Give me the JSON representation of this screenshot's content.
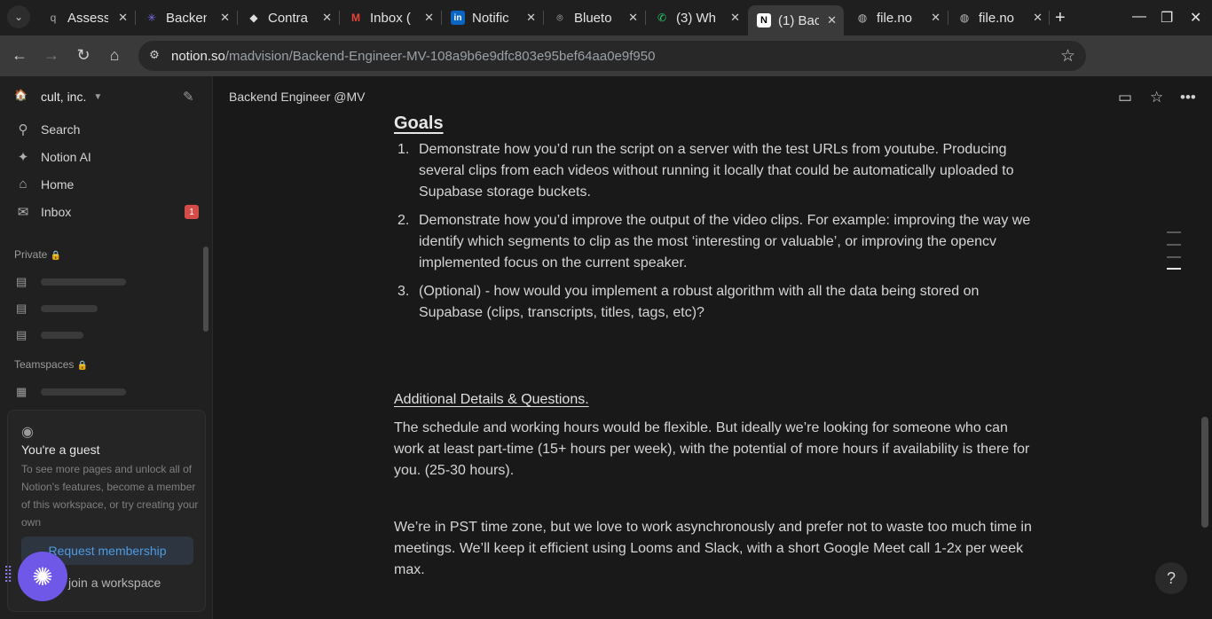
{
  "browser": {
    "tabs": [
      {
        "title": "Assess",
        "icon": "q"
      },
      {
        "title": "Backen",
        "icon": "✳"
      },
      {
        "title": "Contra",
        "icon": "◆"
      },
      {
        "title": "Inbox (",
        "icon": "M"
      },
      {
        "title": "Notific",
        "icon": "in"
      },
      {
        "title": "Blueto",
        "icon": "⌾"
      },
      {
        "title": "(3) Wh",
        "icon": "✆"
      },
      {
        "title": "(1) Bac",
        "icon": "N"
      },
      {
        "title": "file.no",
        "icon": "◍"
      },
      {
        "title": "file.no",
        "icon": "◍"
      }
    ],
    "url_host": "notion.so",
    "url_path": "/madvision/Backend-Engineer-MV-108a9b6e9dfc803e95bef64aa0e9f950"
  },
  "sidebar": {
    "workspace": "cult, inc.",
    "nav": [
      {
        "label": "Search",
        "icon": "search-icon"
      },
      {
        "label": "Notion AI",
        "icon": "sparkle-icon"
      },
      {
        "label": "Home",
        "icon": "home-icon"
      },
      {
        "label": "Inbox",
        "icon": "inbox-icon",
        "badge": "1"
      }
    ],
    "private_label": "Private",
    "teamspaces_label": "Teamspaces",
    "guest": {
      "title": "You're a guest",
      "text": "To see more pages and unlock all of Notion's features, become a member of this workspace, or try creating your own",
      "request": "Request membership",
      "join": "e or join a workspace"
    }
  },
  "page": {
    "breadcrumb": "Backend Engineer @MV",
    "goals_heading": "Goals",
    "goals": [
      {
        "num": "1.",
        "text": "Demonstrate how you’d run the script on a server with the test URLs from youtube. Producing several clips from each videos without running it locally that could be automatically uploaded to Supabase storage buckets."
      },
      {
        "num": "2.",
        "text": "Demonstrate how you’d improve the output of the video clips. For example: improving the way we identify which segments to clip as the most ‘interesting or valuable’, or improving the opencv implemented focus on the current speaker."
      },
      {
        "num": "3.",
        "text": "(Optional) - how would you implement a robust algorithm with all the data being stored on Supabase (clips, transcripts, titles, tags, etc)?"
      }
    ],
    "details_heading": "Additional Details & Questions.",
    "para1": "The schedule and working hours would be flexible. But ideally we’re looking for someone who can work at least part-time (15+ hours per week), with the potential of more hours if availability is there for you. (25-30 hours).",
    "para2": "We’re in PST time zone, but we love to work asynchronously and prefer not to waste too much time in meetings. We’ll keep it efficient using Looms and Slack, with a short Google Meet call 1-2x per week max.",
    "help": "?"
  }
}
